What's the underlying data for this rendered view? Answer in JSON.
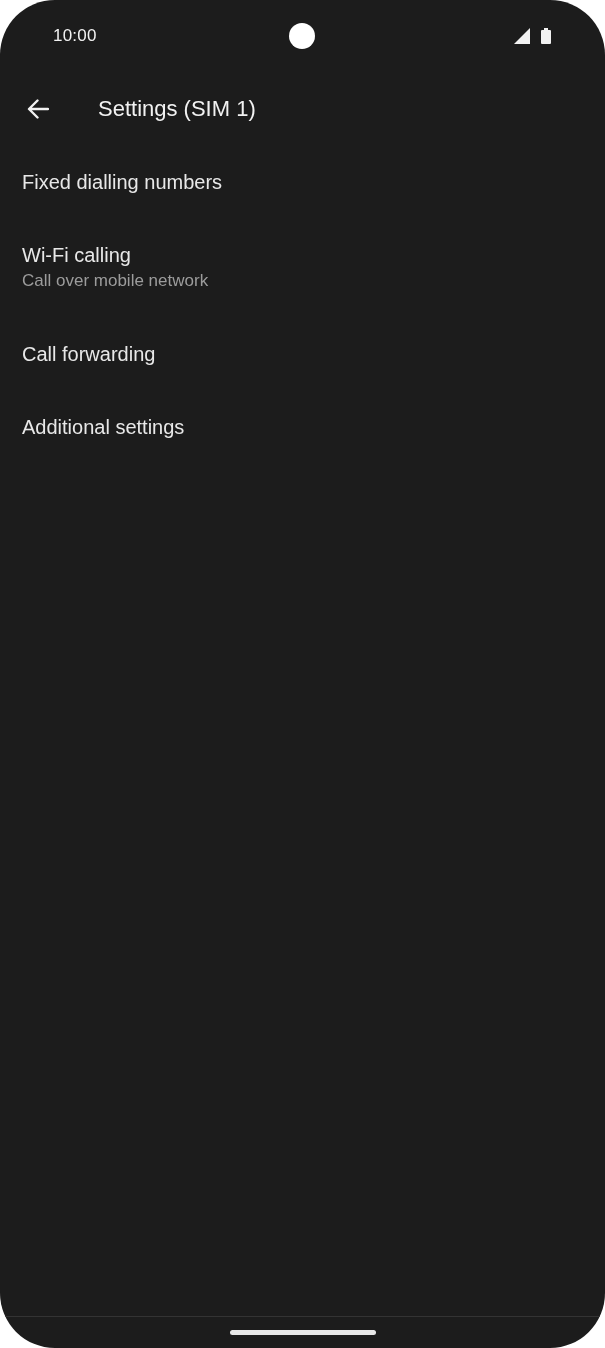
{
  "status_bar": {
    "time": "10:00"
  },
  "app_bar": {
    "title": "Settings (SIM 1)"
  },
  "items": [
    {
      "title": "Fixed dialling numbers"
    },
    {
      "title": "Wi-Fi calling",
      "summary": "Call over mobile network"
    },
    {
      "title": "Call forwarding"
    },
    {
      "title": "Additional settings"
    }
  ]
}
